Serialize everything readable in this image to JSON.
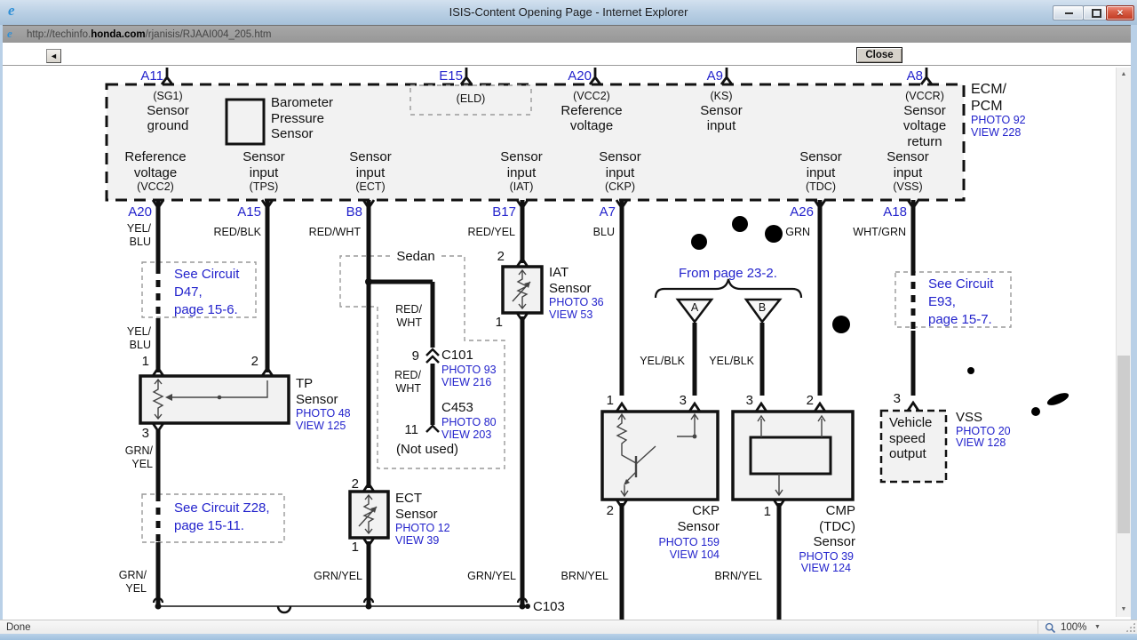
{
  "window": {
    "title": "ISIS-Content Opening Page - Internet Explorer",
    "ie_icon": "e",
    "close_glyph": "×"
  },
  "address": {
    "prefix": "http://techinfo.",
    "domain": "honda.com",
    "path": "/rjanisis/RJAAI004_205.htm"
  },
  "toolbar": {
    "back_icon": "◄",
    "close_label": "Close"
  },
  "statusbar": {
    "status": "Done",
    "zoom": "100%",
    "dropdown_icon": "▼"
  },
  "scrollbar": {
    "up_icon": "▲",
    "down_icon": "▼"
  },
  "diagram": {
    "ecm": {
      "name": "ECM/\nPCM",
      "photo": "PHOTO 92",
      "view": "VIEW 228",
      "a11": "A11",
      "sg1_code": "(SG1)",
      "sg1_label": "Sensor\nground",
      "baro_label": "Barometer\nPressure\nSensor",
      "e15": "E15",
      "eld_code": "(ELD)",
      "a20": "A20",
      "vcc2_code": "(VCC2)",
      "vcc2_label": "Reference\nvoltage",
      "a9": "A9",
      "ks_code": "(KS)",
      "ks_label": "Sensor\ninput",
      "a8": "A8",
      "vccr_code": "(VCCR)",
      "vccr_label": "Sensor\nvoltage\nreturn",
      "out_ref_label": "Reference\nvoltage",
      "out_ref_code": "(VCC2)",
      "sensor_input": "Sensor\ninput",
      "out_tps_code": "(TPS)",
      "out_ect_code": "(ECT)",
      "out_iat_code": "(IAT)",
      "out_ckp_code": "(CKP)",
      "out_tdc_code": "(TDC)",
      "out_vss_code": "(VSS)"
    },
    "pins": {
      "a20": "A20",
      "a15": "A15",
      "b8": "B8",
      "b17": "B17",
      "a7": "A7",
      "a26": "A26",
      "a18": "A18"
    },
    "wires": {
      "yel_blu": "YEL/\nBLU",
      "red_blk": "RED/BLK",
      "red_wht": "RED/WHT",
      "red_wht_2": "RED/\nWHT",
      "red_yel": "RED/YEL",
      "blu": "BLU",
      "grn": "GRN",
      "wht_grn": "WHT/GRN",
      "yel_blk": "YEL/BLK",
      "grn_yel": "GRN/YEL",
      "grn_yel_2": "GRN/\nYEL",
      "brn_yel": "BRN/YEL"
    },
    "notes": {
      "sedan": "Sedan",
      "d47": "See Circuit\nD47,\npage 15-6.",
      "e93": "See Circuit\nE93,\npage 15-7.",
      "z28": "See Circuit Z28,\npage 15-11.",
      "from_page": "From page 23-2.",
      "not_used": "(Not used)"
    },
    "conn": {
      "c101": "C101",
      "c101_photo": "PHOTO 93",
      "c101_view": "VIEW 216",
      "c453": "C453",
      "c453_photo": "PHOTO 80",
      "c453_view": "VIEW 203",
      "c103": "C103"
    },
    "tp": {
      "name": "TP\nSensor",
      "photo": "PHOTO 48",
      "view": "VIEW 125"
    },
    "ect": {
      "name": "ECT\nSensor",
      "photo": "PHOTO 12",
      "view": "VIEW 39"
    },
    "iat": {
      "name": "IAT\nSensor",
      "photo": "PHOTO 36",
      "view": "VIEW 53"
    },
    "ckp": {
      "name": "CKP\nSensor",
      "photo": "PHOTO 159",
      "view": "VIEW 104"
    },
    "cmp": {
      "name": "CMP\n(TDC)\nSensor",
      "photo": "PHOTO 39",
      "view": "VIEW 124"
    },
    "vss": {
      "name": "VSS",
      "photo": "PHOTO 20",
      "view": "VIEW 128",
      "box_label": "Vehicle\nspeed\noutput"
    },
    "nums": {
      "n1": "1",
      "n2": "2",
      "n3": "3",
      "n9": "9",
      "n11": "11"
    },
    "tri": {
      "a": "A",
      "b": "B"
    }
  }
}
